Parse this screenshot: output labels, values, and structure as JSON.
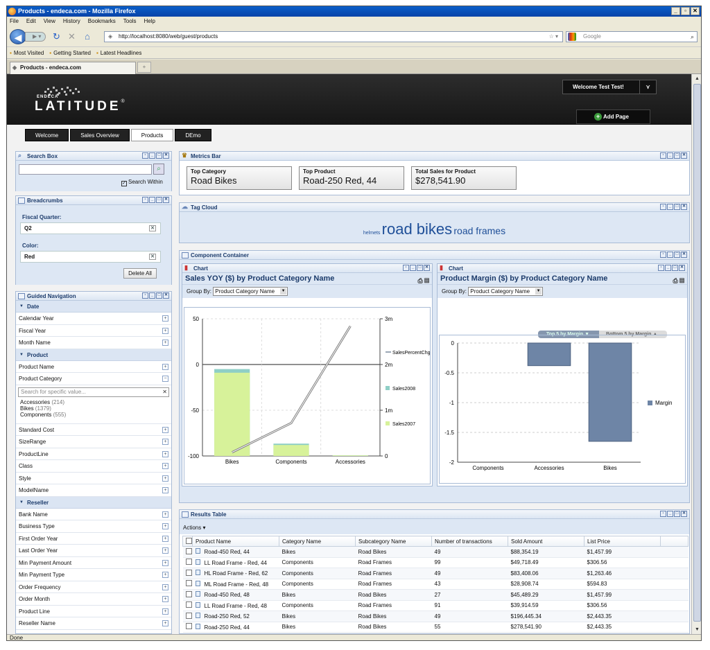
{
  "browser": {
    "window_title": "Products - endeca.com - Mozilla Firefox",
    "menu": [
      "File",
      "Edit",
      "View",
      "History",
      "Bookmarks",
      "Tools",
      "Help"
    ],
    "url": "http://localhost:8080/web/guest/products",
    "search_placeholder": "Google",
    "bookmarks": [
      "Most Visited",
      "Getting Started",
      "Latest Headlines"
    ],
    "tab_title": "Products - endeca.com",
    "status": "Done"
  },
  "header": {
    "logo_small": "ENDECA",
    "logo_big": "LATITUDE",
    "welcome": "Welcome Test Test!",
    "add_page": "Add Page"
  },
  "page_tabs": [
    "Welcome",
    "Sales Overview",
    "Products",
    "DEmo"
  ],
  "active_tab": "Products",
  "search_box": {
    "title": "Search Box",
    "within_label": "Search Within",
    "value": ""
  },
  "breadcrumbs": {
    "title": "Breadcrumbs",
    "items": [
      {
        "label": "Fiscal Quarter:",
        "value": "Q2"
      },
      {
        "label": "Color:",
        "value": "Red"
      }
    ],
    "delete_all": "Delete All"
  },
  "guided_nav": {
    "title": "Guided Navigation",
    "date_group": "Date",
    "date_items": [
      "Calendar Year",
      "Fiscal Year",
      "Month Name"
    ],
    "product_group": "Product",
    "product_items": [
      "Product Name",
      "Product Category"
    ],
    "expanded": {
      "placeholder": "Search for specific value...",
      "values": [
        {
          "name": "Accessories",
          "count": "(214)"
        },
        {
          "name": "Bikes",
          "count": "(1379)"
        },
        {
          "name": "Components",
          "count": "(555)"
        }
      ]
    },
    "product_items2": [
      "Standard Cost",
      "SizeRange",
      "ProductLine",
      "Class",
      "Style",
      "ModelName"
    ],
    "reseller_group": "Reseller",
    "reseller_items": [
      "Bank Name",
      "Business Type",
      "First Order Year",
      "Last Order Year",
      "Min Payment Amount",
      "Min Payment Type",
      "Order Frequency",
      "Order Month",
      "Product Line",
      "Reseller Name"
    ]
  },
  "metrics_bar": {
    "title": "Metrics Bar",
    "metrics": [
      {
        "label": "Top Category",
        "value": "Road Bikes"
      },
      {
        "label": "Top Product",
        "value": "Road-250 Red, 44"
      },
      {
        "label": "Total Sales for Product",
        "value": "$278,541.90"
      }
    ]
  },
  "tag_cloud": {
    "title": "Tag Cloud",
    "tags": [
      {
        "text": "helmets",
        "size": "small"
      },
      {
        "text": "road bikes",
        "size": "large"
      },
      {
        "text": "road frames",
        "size": "medium"
      }
    ]
  },
  "component_container": {
    "title": "Component Container"
  },
  "chart1": {
    "portlet_title": "Chart",
    "title": "Sales YOY ($) by Product Category Name",
    "group_by_label": "Group By:",
    "group_by_value": "Product Category Name"
  },
  "chart2": {
    "portlet_title": "Chart",
    "title": "Product Margin ($) by Product Category Name",
    "group_by_label": "Group By:",
    "group_by_value": "Product Category Name",
    "toggle_top": "Top 5 by Margin",
    "toggle_bottom": "Bottom 5 by Margin"
  },
  "chart_data": [
    {
      "type": "bar",
      "title": "Sales YOY ($) by Product Category Name",
      "categories": [
        "Bikes",
        "Components",
        "Accessories"
      ],
      "series": [
        {
          "name": "Sales2007",
          "axis": "right",
          "values": [
            1820000,
            240000,
            12000
          ],
          "color": "#d7f29a"
        },
        {
          "name": "Sales2008",
          "axis": "right",
          "values": [
            1900000,
            270000,
            14000
          ],
          "color": "#8fcfc6"
        },
        {
          "name": "SalesPercentChg",
          "axis": "left",
          "type": "line",
          "values": [
            -96,
            -64,
            42
          ],
          "color": "#9aa6b5"
        }
      ],
      "y_left": {
        "ticks": [
          50,
          0,
          -50,
          -100
        ],
        "ylim": [
          -100,
          50
        ]
      },
      "y_right": {
        "ticks": [
          "3m",
          "2m",
          "1m",
          "0"
        ],
        "ylim": [
          0,
          3000000
        ]
      },
      "legend": "right",
      "grid": true
    },
    {
      "type": "bar",
      "title": "Product Margin ($) by Product Category Name",
      "categories": [
        "Components",
        "Accessories",
        "Bikes"
      ],
      "series": [
        {
          "name": "Margin",
          "values": [
            0,
            -0.38,
            -1.65
          ],
          "color": "#6e85a6"
        }
      ],
      "y_ticks": [
        "0",
        "-0.5",
        "-1",
        "-1.5",
        "-2"
      ],
      "ylim": [
        -2,
        0
      ],
      "legend": "right",
      "grid": true
    }
  ],
  "results_table": {
    "title": "Results Table",
    "actions": "Actions",
    "columns": [
      "Product Name",
      "Category Name",
      "Subcategory Name",
      "Number of transactions",
      "Sold Amount",
      "List Price"
    ],
    "rows": [
      [
        "Road-450 Red, 44",
        "Bikes",
        "Road Bikes",
        "49",
        "$88,354.19",
        "$1,457.99"
      ],
      [
        "LL Road Frame - Red, 44",
        "Components",
        "Road Frames",
        "99",
        "$49,718.49",
        "$306.56"
      ],
      [
        "HL Road Frame - Red, 62",
        "Components",
        "Road Frames",
        "49",
        "$83,408.06",
        "$1,263.46"
      ],
      [
        "ML Road Frame - Red, 48",
        "Components",
        "Road Frames",
        "43",
        "$28,908.74",
        "$594.83"
      ],
      [
        "Road-450 Red, 48",
        "Bikes",
        "Road Bikes",
        "27",
        "$45,489.29",
        "$1,457.99"
      ],
      [
        "LL Road Frame - Red, 48",
        "Components",
        "Road Frames",
        "91",
        "$39,914.59",
        "$306.56"
      ],
      [
        "Road-250 Red, 52",
        "Bikes",
        "Road Bikes",
        "49",
        "$196,445.34",
        "$2,443.35"
      ],
      [
        "Road-250 Red, 44",
        "Bikes",
        "Road Bikes",
        "55",
        "$278,541.90",
        "$2,443.35"
      ]
    ]
  }
}
